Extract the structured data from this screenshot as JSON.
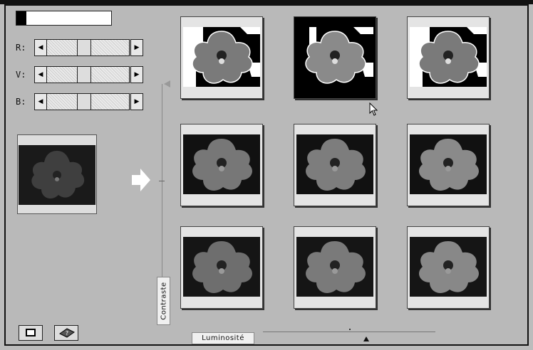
{
  "color_adjust": {
    "swatch_color": "#000000",
    "sliders": [
      {
        "label": "R:",
        "value": 0.62
      },
      {
        "label": "V:",
        "value": 0.62
      },
      {
        "label": "B:",
        "value": 0.62
      }
    ]
  },
  "axes": {
    "contrast_label": "Contraste",
    "luminosity_label": "Luminosité"
  },
  "grid": {
    "selected_index": 1,
    "variants": [
      {
        "name": "high-contrast-low-lum"
      },
      {
        "name": "high-contrast-mid-lum"
      },
      {
        "name": "high-contrast-high-lum"
      },
      {
        "name": "mid-contrast-low-lum"
      },
      {
        "name": "mid-contrast-mid-lum"
      },
      {
        "name": "mid-contrast-high-lum"
      },
      {
        "name": "low-contrast-low-lum"
      },
      {
        "name": "low-contrast-mid-lum"
      },
      {
        "name": "low-contrast-high-lum"
      }
    ]
  },
  "icons": {
    "window_button": "window-icon",
    "help_button": "help-book-icon",
    "proceed_arrow": "arrow-right-icon",
    "pointer": "mouse-cursor-icon"
  }
}
